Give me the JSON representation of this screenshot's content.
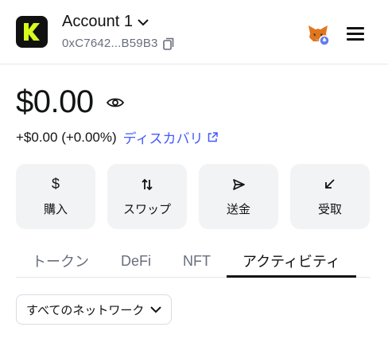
{
  "header": {
    "account_name": "Account 1",
    "account_address": "0xC7642...B59B3",
    "brand_color": "#D7FF1E"
  },
  "balance": {
    "amount": "$0.00",
    "change": "+$0.00 (+0.00%)",
    "portfolio_link": "ディスカバリ"
  },
  "actions": [
    {
      "label": "購入",
      "icon": "dollar-icon"
    },
    {
      "label": "スワップ",
      "icon": "swap-icon"
    },
    {
      "label": "送金",
      "icon": "send-icon"
    },
    {
      "label": "受取",
      "icon": "receive-icon"
    }
  ],
  "tabs": [
    "トークン",
    "DeFi",
    "NFT",
    "アクティビティ"
  ],
  "active_tab": "アクティビティ",
  "network_filter": "すべてのネットワーク",
  "colors": {
    "accent": "#4459FF",
    "text": "#121314",
    "muted": "#686E7D"
  }
}
